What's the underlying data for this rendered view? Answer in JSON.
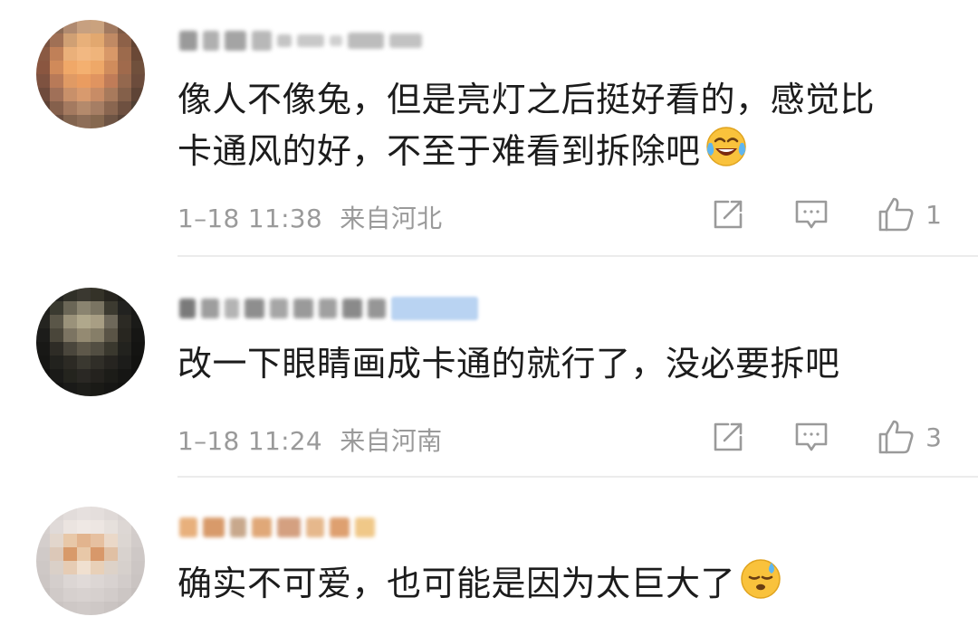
{
  "comments": [
    {
      "text_line1": "像人不像兔，但是亮灯之后挺好看的，感觉比",
      "text_line2": "卡通风的好，不至于难看到拆除吧",
      "emoji": "laughing-crying-emoji",
      "time": "1–18 11:38",
      "location": "来自河北",
      "likes": "1"
    },
    {
      "text_line1": "改一下眼睛画成卡通的就行了，没必要拆吧",
      "time": "1–18 11:24",
      "location": "来自河南",
      "likes": "3"
    },
    {
      "text_line1": "确实不可爱，也可能是因为太巨大了",
      "emoji": "sweat-emoji"
    }
  ],
  "icons": {
    "share": "share-icon",
    "reply": "comment-icon",
    "like": "thumbs-up-icon"
  },
  "colors": {
    "meta_gray": "#9a9a9a",
    "divider": "#ececec",
    "verified_badge": "#b9d3f2"
  }
}
